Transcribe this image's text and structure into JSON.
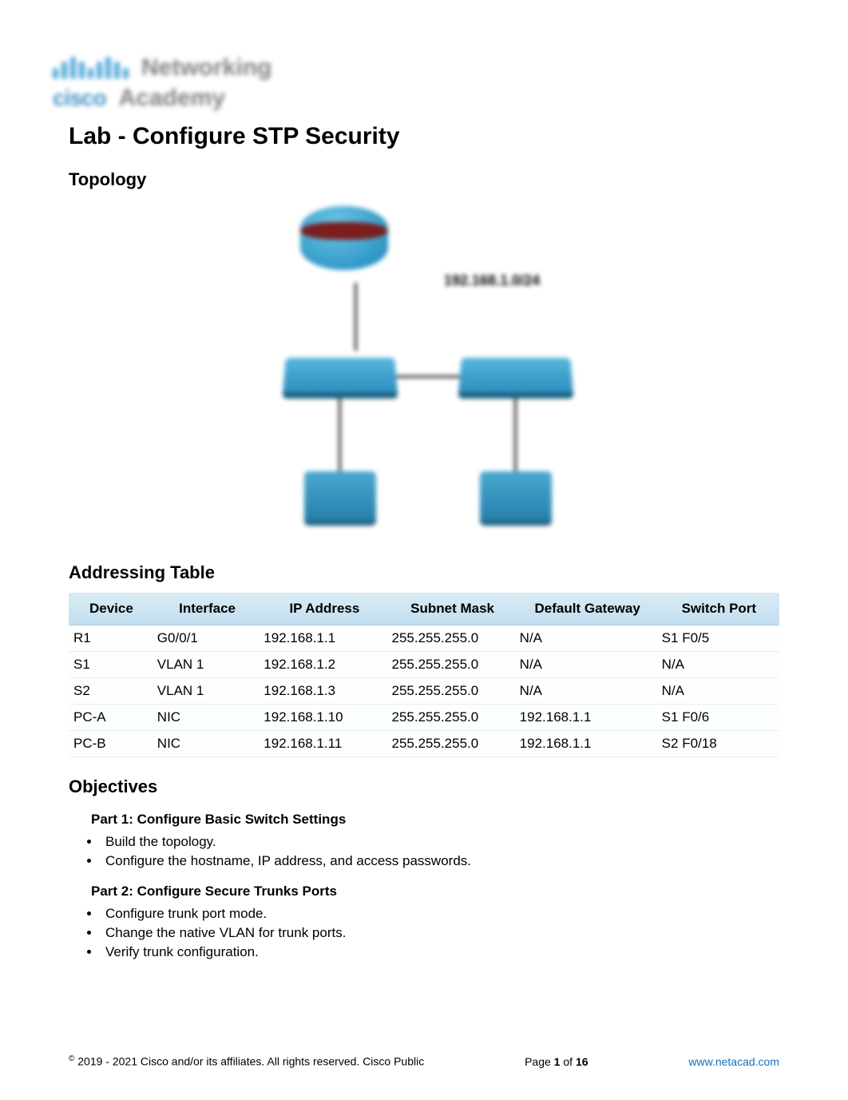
{
  "logo": {
    "line1": "Networking",
    "line2a": "cisco",
    "line2b": "Academy"
  },
  "title": "Lab - Configure STP Security",
  "sections": {
    "topology": "Topology",
    "addressing": "Addressing Table",
    "objectives": "Objectives"
  },
  "topology": {
    "network_label": "192.168.1.0/24"
  },
  "addressing_table": {
    "headers": [
      "Device",
      "Interface",
      "IP Address",
      "Subnet Mask",
      "Default Gateway",
      "Switch Port"
    ],
    "rows": [
      {
        "device": "R1",
        "interface": "G0/0/1",
        "ip": "192.168.1.1",
        "mask": "255.255.255.0",
        "gw": "N/A",
        "port": "S1 F0/5"
      },
      {
        "device": "S1",
        "interface": "VLAN 1",
        "ip": "192.168.1.2",
        "mask": "255.255.255.0",
        "gw": "N/A",
        "port": "N/A"
      },
      {
        "device": "S2",
        "interface": "VLAN 1",
        "ip": "192.168.1.3",
        "mask": "255.255.255.0",
        "gw": "N/A",
        "port": "N/A"
      },
      {
        "device": "PC-A",
        "interface": "NIC",
        "ip": "192.168.1.10",
        "mask": "255.255.255.0",
        "gw": "192.168.1.1",
        "port": "S1 F0/6"
      },
      {
        "device": "PC-B",
        "interface": "NIC",
        "ip": "192.168.1.11",
        "mask": "255.255.255.0",
        "gw": "192.168.1.1",
        "port": "S2 F0/18"
      }
    ]
  },
  "objectives": {
    "part1": {
      "title": "Part 1: Configure Basic Switch Settings",
      "items": [
        "Build the topology.",
        "Configure the hostname, IP address, and access passwords."
      ]
    },
    "part2": {
      "title": "Part 2: Configure Secure Trunks Ports",
      "items": [
        "Configure trunk port mode.",
        "Change the native VLAN for trunk ports.",
        "Verify trunk configuration."
      ]
    }
  },
  "footer": {
    "copyright": "2019 - 2021 Cisco and/or its affiliates. All rights reserved. Cisco Public",
    "page_label": "Page",
    "page_current": "1",
    "page_of": "of",
    "page_total": "16",
    "url": "www.netacad.com"
  }
}
